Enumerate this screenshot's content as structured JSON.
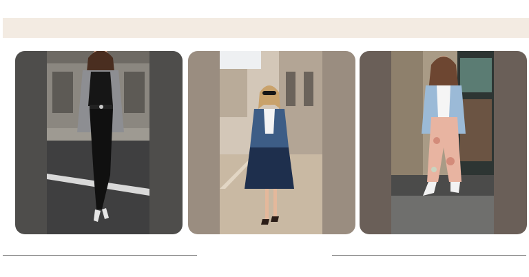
{
  "header_band": {
    "color": "#f3ebe2"
  },
  "cards": [
    {
      "id": "outfit-1",
      "image_alt": "",
      "panel_color": "#4e4d4b",
      "icon": "photo-woman-black-outfit"
    },
    {
      "id": "outfit-2",
      "image_alt": "",
      "panel_color": "#9a8d80",
      "icon": "photo-woman-denim-jacket"
    },
    {
      "id": "outfit-3",
      "image_alt": "",
      "panel_color": "#6a5f58",
      "icon": "photo-woman-blue-blazer"
    }
  ],
  "dividers": {
    "color": "#7c7c7c"
  }
}
